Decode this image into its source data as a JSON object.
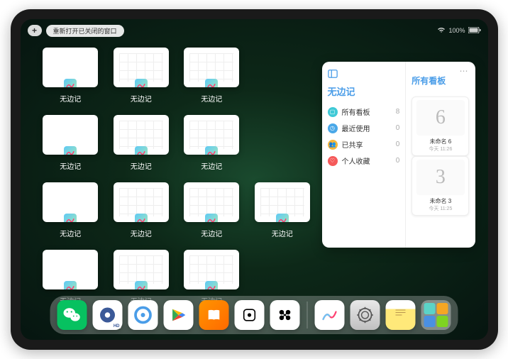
{
  "topbar": {
    "add_label": "+",
    "reopen_label": "重新打开已关闭的窗口",
    "battery_text": "100%"
  },
  "app_name": "无边记",
  "app_tiles": [
    {
      "type": "blank"
    },
    {
      "type": "grid"
    },
    {
      "type": "grid"
    },
    null,
    {
      "type": "blank"
    },
    {
      "type": "grid"
    },
    {
      "type": "grid"
    },
    null,
    {
      "type": "blank"
    },
    {
      "type": "grid"
    },
    {
      "type": "grid"
    },
    {
      "type": "grid"
    },
    {
      "type": "blank"
    },
    {
      "type": "grid"
    },
    {
      "type": "grid"
    },
    null
  ],
  "panel": {
    "left_title": "无边记",
    "right_title": "所有看板",
    "items": [
      {
        "icon_bg": "#3fc9d6",
        "icon_glyph": "▢",
        "label": "所有看板",
        "count": "8"
      },
      {
        "icon_bg": "#4aa8e8",
        "icon_glyph": "◷",
        "label": "最近使用",
        "count": "0"
      },
      {
        "icon_bg": "#f5b73c",
        "icon_glyph": "👥",
        "label": "已共享",
        "count": "0"
      },
      {
        "icon_bg": "#f55a5a",
        "icon_glyph": "♡",
        "label": "个人收藏",
        "count": "0"
      }
    ],
    "boards": [
      {
        "preview": "6",
        "name": "未命名 6",
        "time": "今天 11:26"
      },
      {
        "preview": "3",
        "name": "未命名 3",
        "time": "今天 11:25"
      }
    ]
  },
  "dock": {
    "apps": [
      {
        "name": "wechat",
        "bg": "#07c160"
      },
      {
        "name": "quark",
        "bg": "#ffffff"
      },
      {
        "name": "qq-browser",
        "bg": "#ffffff"
      },
      {
        "name": "play",
        "bg": "#ffffff"
      },
      {
        "name": "books",
        "bg": "linear-gradient(135deg,#ff9500,#ff6a00)"
      },
      {
        "name": "dice",
        "bg": "#ffffff"
      },
      {
        "name": "game",
        "bg": "#ffffff"
      }
    ],
    "recent": [
      {
        "name": "freeform",
        "bg": "#ffffff"
      },
      {
        "name": "settings",
        "bg": "linear-gradient(#e8e8e8,#c0c0c0)"
      },
      {
        "name": "notes",
        "bg": "linear-gradient(#fff 30%,#ffe97a 30%)"
      }
    ]
  }
}
